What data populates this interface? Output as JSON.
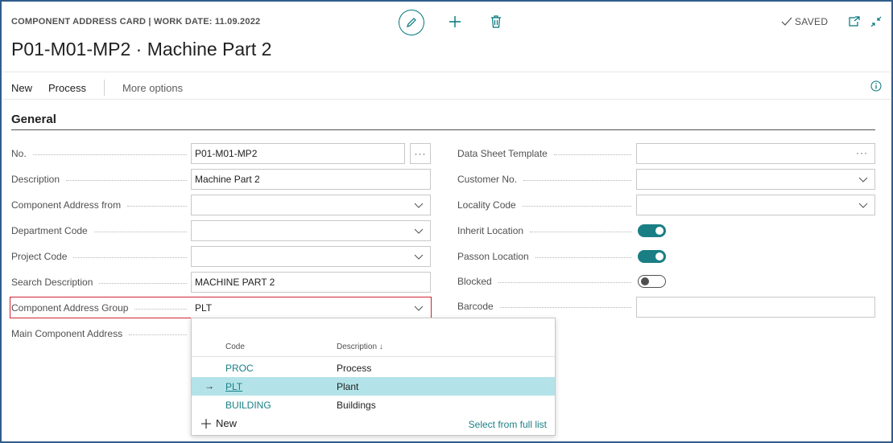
{
  "header": {
    "caption": "COMPONENT ADDRESS CARD | WORK DATE: 11.09.2022",
    "title": "P01-M01-MP2 · Machine Part 2",
    "status": "SAVED",
    "icons": [
      "edit-icon",
      "plus-icon",
      "delete-icon",
      "checkmark-icon",
      "popout-icon",
      "collapse-icon"
    ]
  },
  "actions": {
    "new_label": "New",
    "process_label": "Process",
    "more_label": "More options"
  },
  "section": {
    "title": "General"
  },
  "left_fields": [
    {
      "label": "No.",
      "value": "P01-M01-MP2"
    },
    {
      "label": "Description",
      "value": "Machine Part 2"
    },
    {
      "label": "Component Address from",
      "value": ""
    },
    {
      "label": "Department Code",
      "value": ""
    },
    {
      "label": "Project Code",
      "value": ""
    },
    {
      "label": "Search Description",
      "value": "MACHINE PART 2"
    },
    {
      "label": "Component Address Group",
      "value": "PLT"
    },
    {
      "label": "Main Component Address",
      "value": ""
    }
  ],
  "right_fields": [
    {
      "label": "Data Sheet Template",
      "value": ""
    },
    {
      "label": "Customer No.",
      "value": ""
    },
    {
      "label": "Locality Code",
      "value": ""
    },
    {
      "label": "Inherit Location",
      "toggle": true
    },
    {
      "label": "Passon Location",
      "toggle": true
    },
    {
      "label": "Blocked",
      "toggle": false
    },
    {
      "label": "Barcode",
      "value": ""
    }
  ],
  "lookup": {
    "col_code": "Code",
    "col_desc": "Description ↓",
    "rows": [
      {
        "code": "PROC",
        "desc": "Process",
        "selected": false
      },
      {
        "code": "PLT",
        "desc": "Plant",
        "selected": true
      },
      {
        "code": "BUILDING",
        "desc": "Buildings",
        "selected": false
      }
    ],
    "new_label": "New",
    "full_list_label": "Select from full list"
  },
  "colors": {
    "accent": "#00757a",
    "selected_row": "#b3e3e8",
    "highlight_border": "#d0242f"
  }
}
